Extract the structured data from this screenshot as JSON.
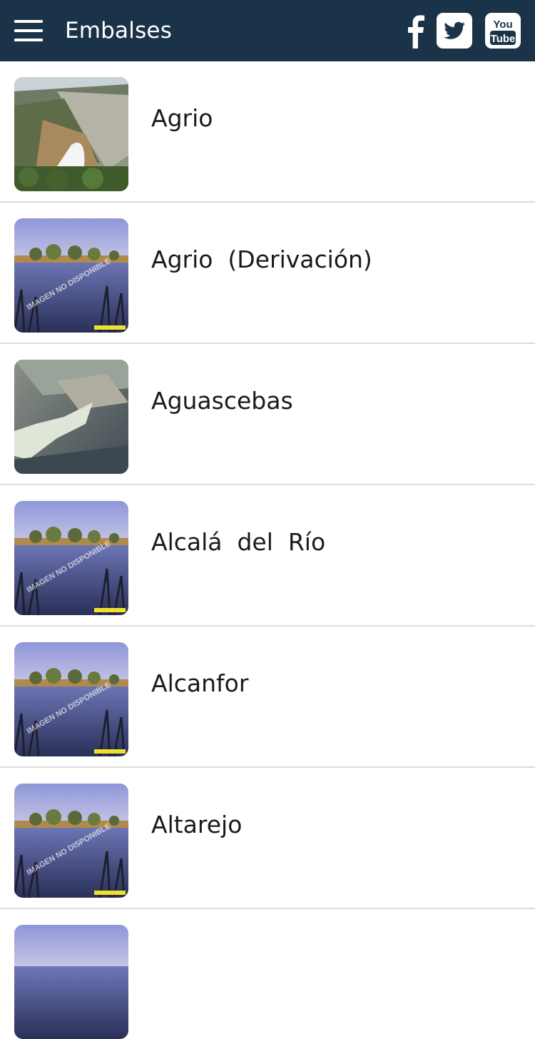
{
  "header": {
    "title": "Embalses",
    "background": "#1a3349",
    "social": [
      "facebook-icon",
      "twitter-icon",
      "youtube-icon"
    ],
    "youtube_text_1": "You",
    "youtube_text_2": "Tube"
  },
  "list": {
    "items": [
      {
        "label": "Agrio",
        "image": "dam-spillway-photo"
      },
      {
        "label": "Agrio  (Derivación)",
        "image": "placeholder-lake-photo"
      },
      {
        "label": "Aguascebas",
        "image": "aerial-reservoir-photo"
      },
      {
        "label": "Alcalá  del  Río",
        "image": "placeholder-lake-photo"
      },
      {
        "label": "Alcanfor",
        "image": "placeholder-lake-photo"
      },
      {
        "label": "Altarejo",
        "image": "placeholder-lake-photo"
      }
    ],
    "placeholder_watermark": "IMAGEN NO DISPONIBLE"
  }
}
